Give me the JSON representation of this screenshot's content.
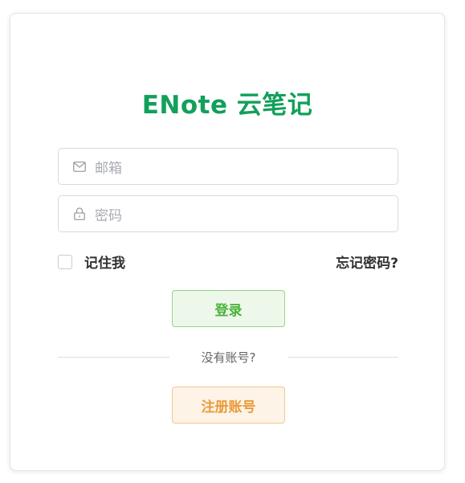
{
  "app": {
    "title": "ENote 云笔记"
  },
  "form": {
    "email_placeholder": "邮箱",
    "password_placeholder": "密码",
    "remember_label": "记住我",
    "remember_checked": false,
    "forgot_label": "忘记密码?",
    "login_label": "登录",
    "divider_text": "没有账号?",
    "register_label": "注册账号"
  },
  "icons": {
    "email": "mail-icon",
    "password": "lock-icon"
  },
  "colors": {
    "brand": "#12a05a",
    "login_text": "#4bb33b",
    "login_bg": "#eef8ea",
    "register_text": "#e89b3a",
    "register_bg": "#fdf3e6"
  }
}
